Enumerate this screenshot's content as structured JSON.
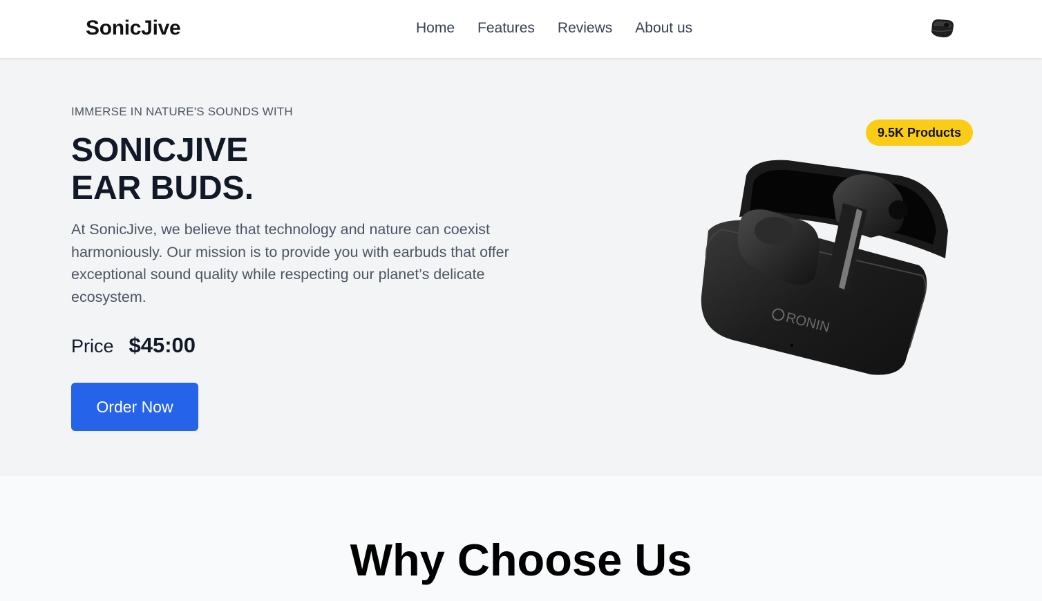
{
  "navbar": {
    "brand": "SonicJive",
    "links": [
      "Home",
      "Features",
      "Reviews",
      "About us"
    ],
    "cart_icon": "earbuds-icon"
  },
  "hero": {
    "eyebrow": "IMMERSE IN NATURE'S SOUNDS WITH",
    "headline_line1": "SONICJIVE",
    "headline_line2": "EAR BUDS.",
    "description": "At SonicJive, we believe that technology and nature can coexist harmoniously. Our mission is to provide you with earbuds that offer exceptional sound quality while respecting our planet’s delicate ecosystem.",
    "price_label": "Price",
    "price_value": "$45:00",
    "cta_label": "Order Now",
    "badge": "9.5K Products",
    "product_brand_text": "RONIN"
  },
  "why": {
    "title": "Why Choose Us"
  },
  "colors": {
    "accent": "#2563eb",
    "badge": "#facc15",
    "hero_bg": "#f3f4f6",
    "headline": "#111827"
  }
}
